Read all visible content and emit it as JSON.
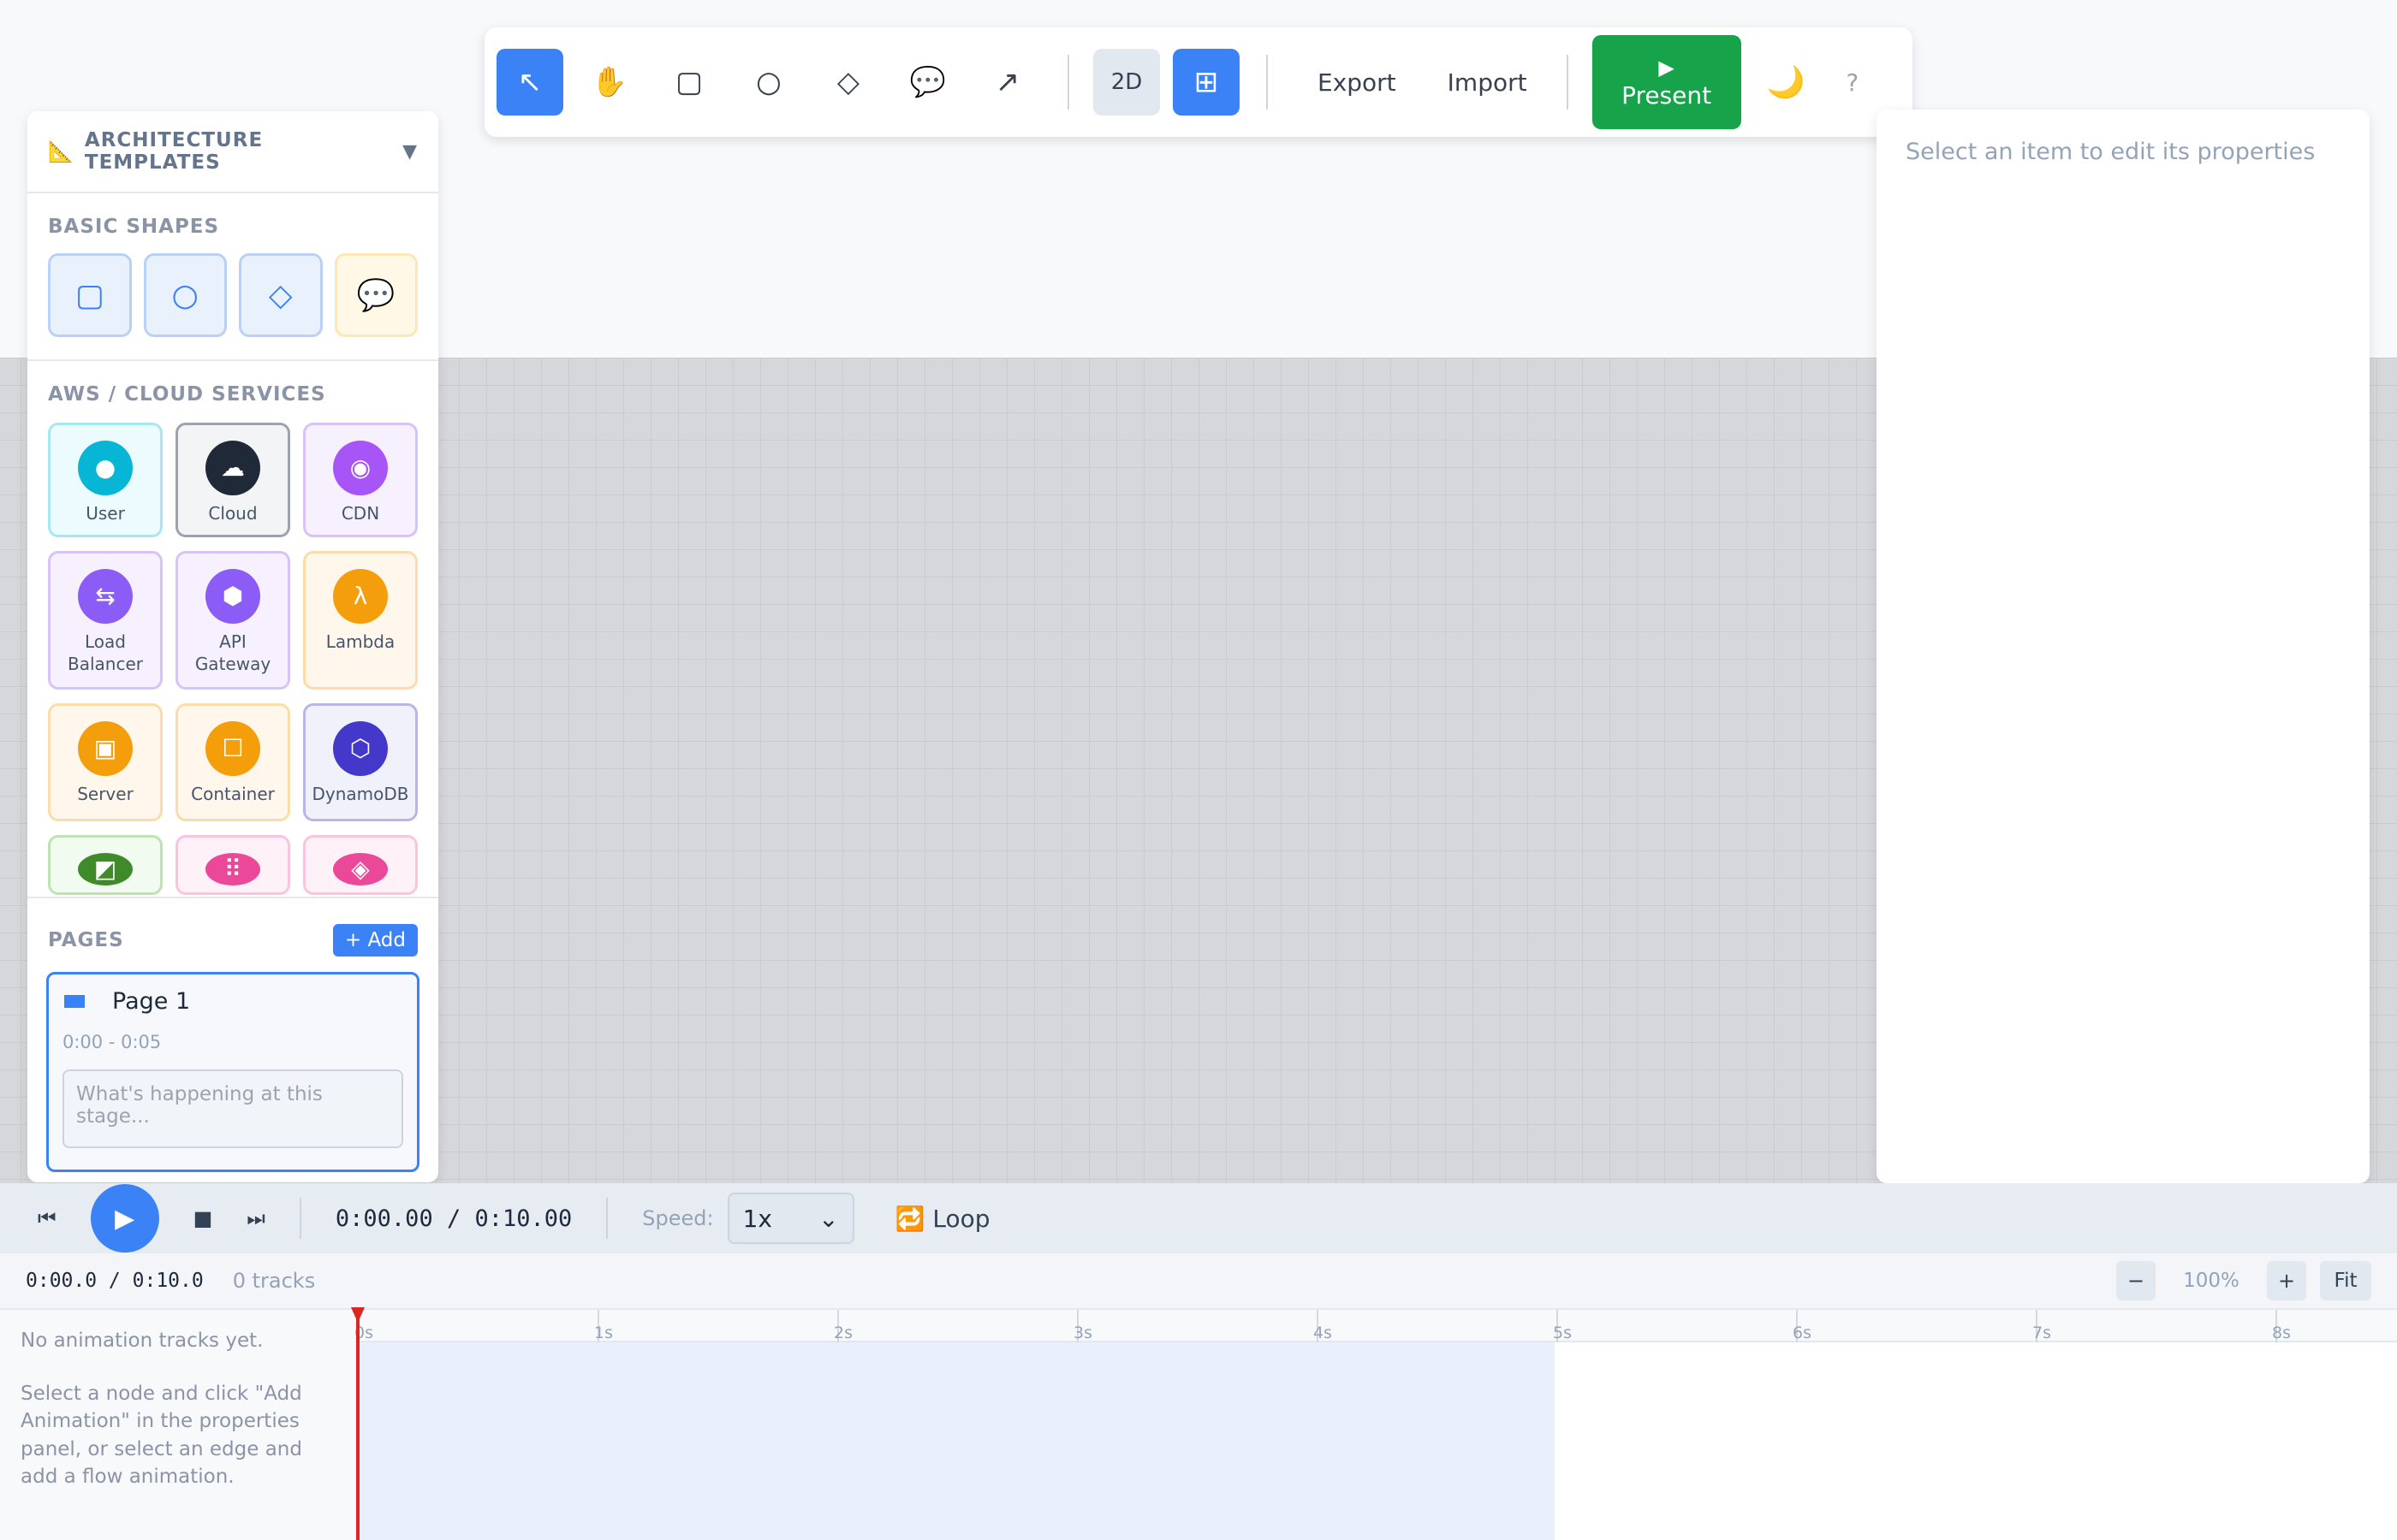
{
  "toolbar": {
    "tools": [
      {
        "name": "select",
        "glyph": "↖"
      },
      {
        "name": "pan",
        "glyph": "✋"
      },
      {
        "name": "rectangle",
        "glyph": "▢"
      },
      {
        "name": "circle",
        "glyph": "○"
      },
      {
        "name": "diamond",
        "glyph": "◇"
      },
      {
        "name": "comment",
        "glyph": "💬"
      },
      {
        "name": "arrow",
        "glyph": "↗"
      }
    ],
    "mode_label": "2D",
    "grid_glyph": "⊞",
    "export_label": "Export",
    "import_label": "Import",
    "present_glyph": "▶",
    "present_label": "Present",
    "theme_glyph": "🌙",
    "help_glyph": "?"
  },
  "left_panel": {
    "templates_icon": "📐",
    "templates_label": "ARCHITECTURE TEMPLATES",
    "templates_caret": "▼",
    "basic_label": "BASIC SHAPES",
    "basic_shapes": [
      {
        "name": "rectangle",
        "glyph": "▢"
      },
      {
        "name": "circle",
        "glyph": "○"
      },
      {
        "name": "diamond",
        "glyph": "◇"
      },
      {
        "name": "comment",
        "glyph": "💬"
      }
    ],
    "aws_label": "AWS / CLOUD SERVICES",
    "services": [
      {
        "label": "User",
        "glyph": "●",
        "color": "#06b6d4",
        "border": "#a5e8f2",
        "bg": "#ecfbfd"
      },
      {
        "label": "Cloud",
        "glyph": "☁",
        "color": "#1f2937",
        "border": "#9ca3af",
        "bg": "#f3f4f6"
      },
      {
        "label": "CDN",
        "glyph": "◉",
        "color": "#a855f7",
        "border": "#d8c2fb",
        "bg": "#f7f1ff"
      },
      {
        "label": "Load\nBalancer",
        "glyph": "⇆",
        "color": "#8b5cf6",
        "border": "#d8c2fb",
        "bg": "#f7f1ff"
      },
      {
        "label": "API\nGateway",
        "glyph": "⬢",
        "color": "#8b5cf6",
        "border": "#d8c2fb",
        "bg": "#f7f1ff"
      },
      {
        "label": "Lambda",
        "glyph": "λ",
        "color": "#f59e0b",
        "border": "#fcdcaa",
        "bg": "#fff7eb"
      },
      {
        "label": "Server",
        "glyph": "▣",
        "color": "#f59e0b",
        "border": "#fcdcaa",
        "bg": "#fff7eb"
      },
      {
        "label": "Container",
        "glyph": "☐",
        "color": "#f59e0b",
        "border": "#fcdcaa",
        "bg": "#fff7eb"
      },
      {
        "label": "DynamoDB",
        "glyph": "⬡",
        "color": "#4338ca",
        "border": "#b7b5ea",
        "bg": "#f1f1fb"
      },
      {
        "label": "",
        "glyph": "◩",
        "color": "#3f8a2b",
        "border": "#bfe2b3",
        "bg": "#f2fbef"
      },
      {
        "label": "",
        "glyph": "⠿",
        "color": "#ec4899",
        "border": "#f9c4dd",
        "bg": "#fff1f7"
      },
      {
        "label": "",
        "glyph": "◈",
        "color": "#ec4899",
        "border": "#f9c4dd",
        "bg": "#fff1f7"
      }
    ],
    "pages_label": "PAGES",
    "add_label": "+ Add",
    "page": {
      "title": "Page 1",
      "time": "0:00 - 0:05",
      "placeholder": "What's happening at this stage..."
    }
  },
  "right_panel": {
    "empty_text": "Select an item to edit its properties"
  },
  "transport": {
    "skip_start_glyph": "⏮",
    "play_glyph": "▶",
    "stop_glyph": "■",
    "skip_end_glyph": "⏭",
    "timecode": "0:00.00 / 0:10.00",
    "speed_label": "Speed:",
    "speed_value": "1x",
    "speed_caret": "⌄",
    "loop_label": "🔁 Loop"
  },
  "timeline": {
    "timecode": "0:00.0 / 0:10.0",
    "tracks_label": "0 tracks",
    "zoom_out": "−",
    "zoom_pct": "100%",
    "zoom_in": "+",
    "fit_label": "Fit",
    "empty_title": "No animation tracks yet.",
    "empty_help": "Select a node and click \"Add Animation\" in the properties panel, or select an edge and add a flow animation.",
    "ticks": [
      "0s",
      "1s",
      "2s",
      "3s",
      "4s",
      "5s",
      "6s",
      "7s",
      "8s"
    ],
    "duration_s": 10,
    "page_end_s": 5
  }
}
